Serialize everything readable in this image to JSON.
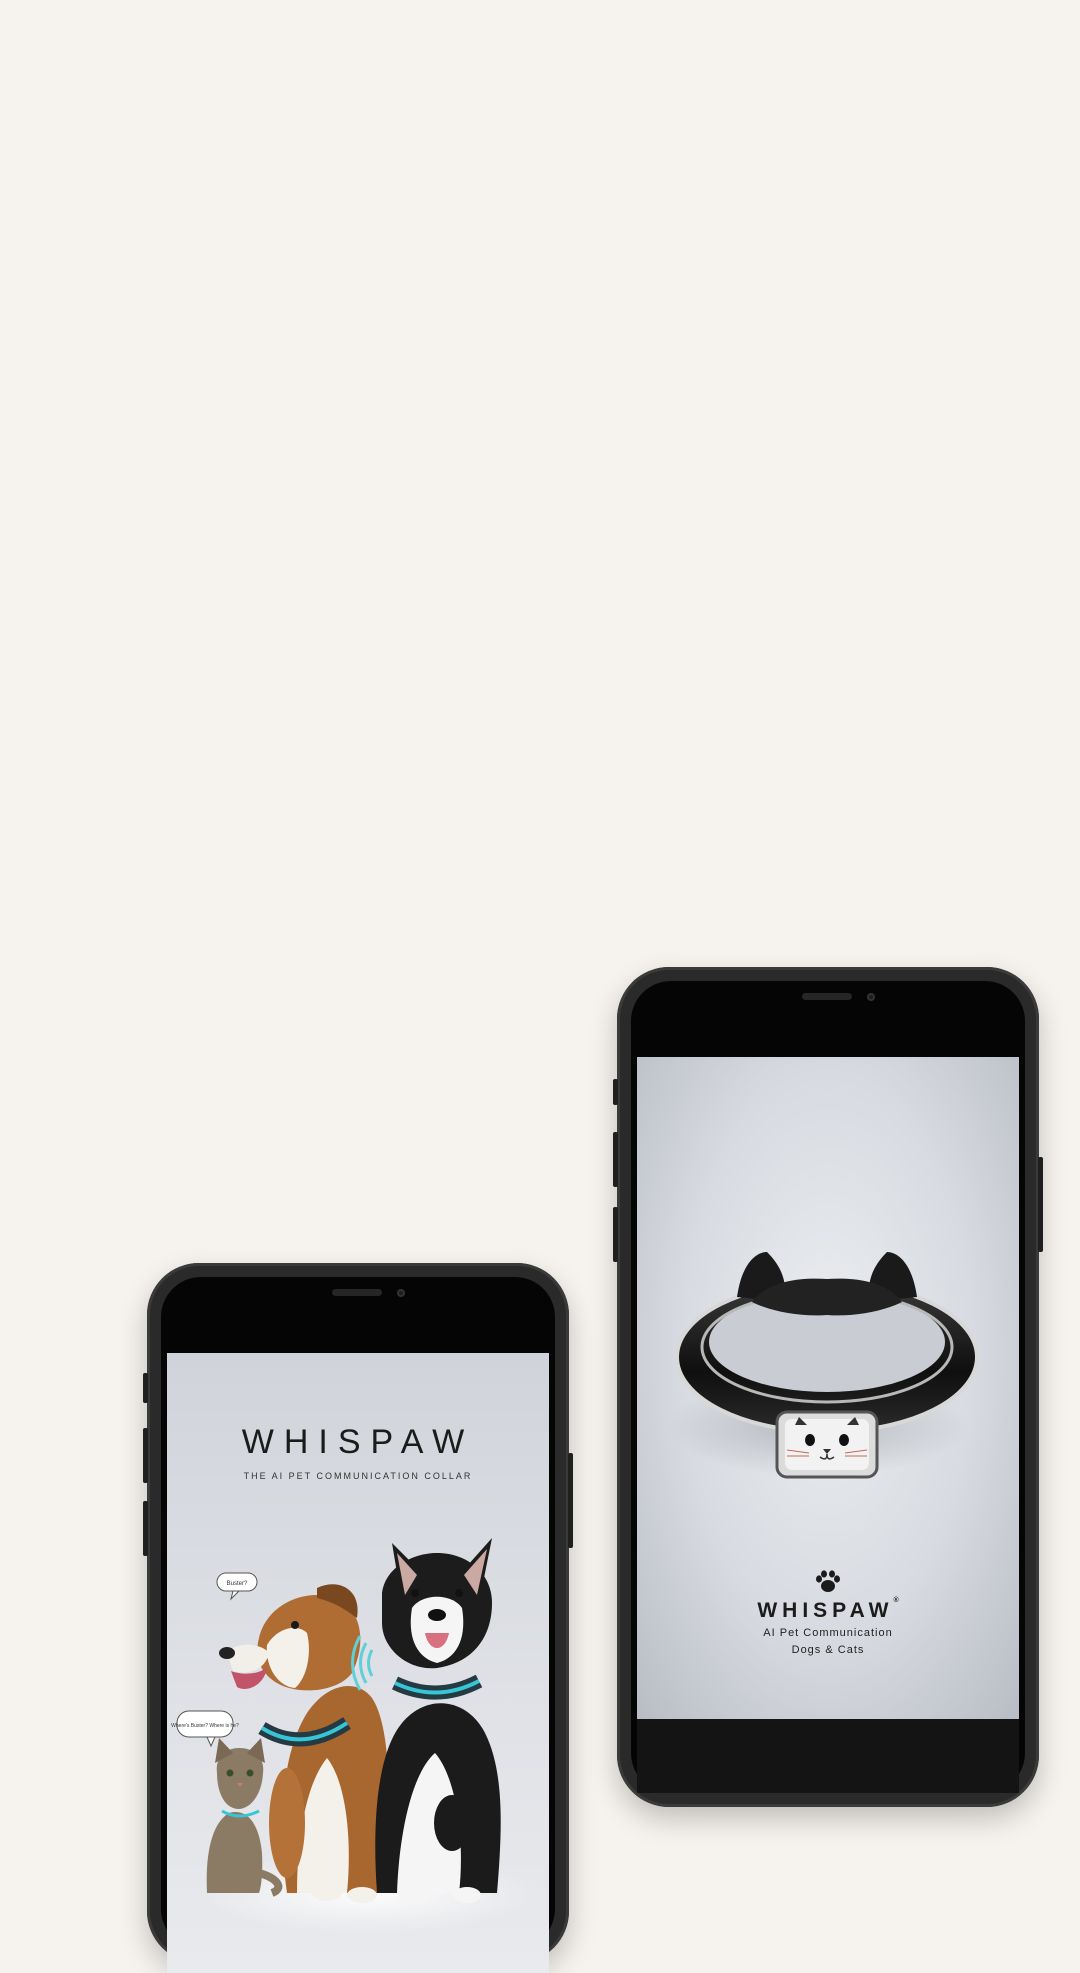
{
  "colors": {
    "background": "#f6f3ee",
    "phone_body": "#2a2a2a",
    "screen_light": "#dfe1e6",
    "collar_glow": "#37c6d6"
  },
  "left_phone": {
    "brand_title": "WHISPAW",
    "brand_subtitle": "THE AI PET COMMUNICATION COLLAR",
    "speech_bubble_dog": "Buster?",
    "speech_bubble_cat": "Where's Buster? Where is he?",
    "icons": [
      "sound-wave-icon"
    ]
  },
  "right_phone": {
    "brand_title": "WHISPAW",
    "trademark": "®",
    "tagline_line1": "AI Pet Communication",
    "tagline_line2": "Dogs & Cats",
    "icons": [
      "paw-icon",
      "cat-face-icon"
    ]
  }
}
